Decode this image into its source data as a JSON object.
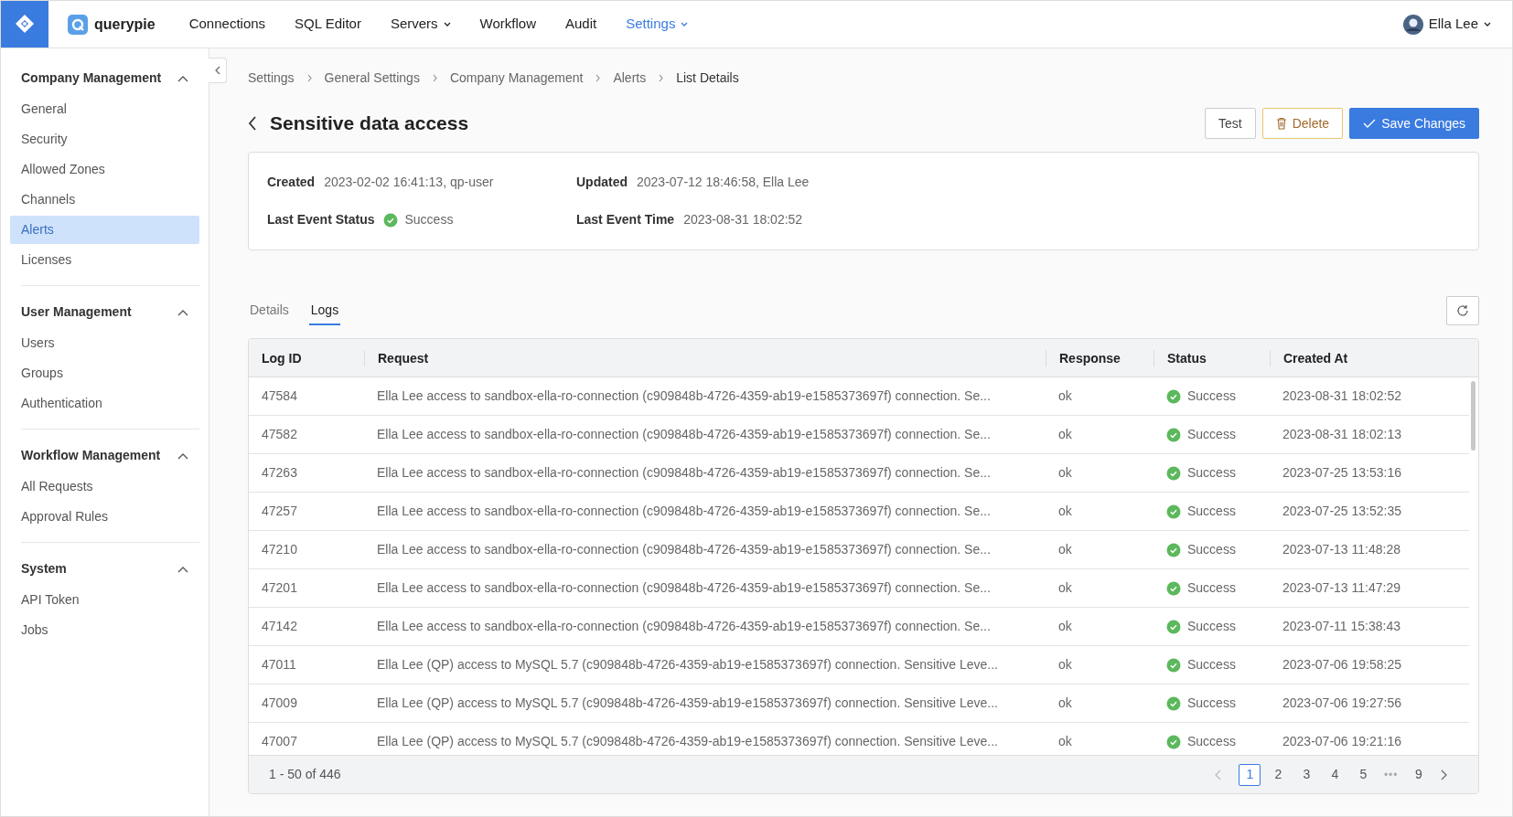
{
  "topbar": {
    "brand": "querypie",
    "nav": [
      {
        "label": "Connections",
        "dropdown": false,
        "selected": false
      },
      {
        "label": "SQL Editor",
        "dropdown": false,
        "selected": false
      },
      {
        "label": "Servers",
        "dropdown": true,
        "selected": false
      },
      {
        "label": "Workflow",
        "dropdown": false,
        "selected": false
      },
      {
        "label": "Audit",
        "dropdown": false,
        "selected": false
      },
      {
        "label": "Settings",
        "dropdown": true,
        "selected": true
      }
    ],
    "user": "Ella Lee"
  },
  "sidebar": {
    "sections": [
      {
        "title": "Company Management",
        "expanded": true,
        "items": [
          {
            "label": "General",
            "selected": false
          },
          {
            "label": "Security",
            "selected": false
          },
          {
            "label": "Allowed Zones",
            "selected": false
          },
          {
            "label": "Channels",
            "selected": false
          },
          {
            "label": "Alerts",
            "selected": true
          },
          {
            "label": "Licenses",
            "selected": false
          }
        ]
      },
      {
        "title": "User Management",
        "expanded": true,
        "items": [
          {
            "label": "Users",
            "selected": false
          },
          {
            "label": "Groups",
            "selected": false
          },
          {
            "label": "Authentication",
            "selected": false
          }
        ]
      },
      {
        "title": "Workflow Management",
        "expanded": true,
        "items": [
          {
            "label": "All Requests",
            "selected": false
          },
          {
            "label": "Approval Rules",
            "selected": false
          }
        ]
      },
      {
        "title": "System",
        "expanded": true,
        "items": [
          {
            "label": "API Token",
            "selected": false
          },
          {
            "label": "Jobs",
            "selected": false
          }
        ]
      }
    ]
  },
  "breadcrumb": [
    "Settings",
    "General Settings",
    "Company Management",
    "Alerts",
    "List Details"
  ],
  "title": "Sensitive data access",
  "actions": [
    {
      "label": "Test",
      "kind": "outline"
    },
    {
      "label": "Delete",
      "kind": "danger"
    },
    {
      "label": "Save Changes",
      "kind": "primary"
    }
  ],
  "info": [
    {
      "label": "Created",
      "value": "2023-02-02 16:41:13, qp-user",
      "kind": "text"
    },
    {
      "label": "Updated",
      "value": "2023-07-12 18:46:58, Ella Lee",
      "kind": "text"
    },
    {
      "label": "Last Event Status",
      "value": "Success",
      "kind": "status"
    },
    {
      "label": "Last Event Time",
      "value": "2023-08-31 18:02:52",
      "kind": "text"
    }
  ],
  "tabs": [
    {
      "label": "Details",
      "selected": false
    },
    {
      "label": "Logs",
      "selected": true
    }
  ],
  "table": {
    "columns": [
      "Log ID",
      "Request",
      "Response",
      "Status",
      "Created At"
    ],
    "rows": [
      {
        "id": "47584",
        "request": "Ella Lee access to sandbox-ella-ro-connection (c909848b-4726-4359-ab19-e1585373697f) connection. Se...",
        "response": "ok",
        "status": "Success",
        "created": "2023-08-31 18:02:52"
      },
      {
        "id": "47582",
        "request": "Ella Lee access to sandbox-ella-ro-connection (c909848b-4726-4359-ab19-e1585373697f) connection. Se...",
        "response": "ok",
        "status": "Success",
        "created": "2023-08-31 18:02:13"
      },
      {
        "id": "47263",
        "request": "Ella Lee access to sandbox-ella-ro-connection (c909848b-4726-4359-ab19-e1585373697f) connection. Se...",
        "response": "ok",
        "status": "Success",
        "created": "2023-07-25 13:53:16"
      },
      {
        "id": "47257",
        "request": "Ella Lee access to sandbox-ella-ro-connection (c909848b-4726-4359-ab19-e1585373697f) connection. Se...",
        "response": "ok",
        "status": "Success",
        "created": "2023-07-25 13:52:35"
      },
      {
        "id": "47210",
        "request": "Ella Lee access to sandbox-ella-ro-connection (c909848b-4726-4359-ab19-e1585373697f) connection. Se...",
        "response": "ok",
        "status": "Success",
        "created": "2023-07-13 11:48:28"
      },
      {
        "id": "47201",
        "request": "Ella Lee access to sandbox-ella-ro-connection (c909848b-4726-4359-ab19-e1585373697f) connection. Se...",
        "response": "ok",
        "status": "Success",
        "created": "2023-07-13 11:47:29"
      },
      {
        "id": "47142",
        "request": "Ella Lee access to sandbox-ella-ro-connection (c909848b-4726-4359-ab19-e1585373697f) connection. Se...",
        "response": "ok",
        "status": "Success",
        "created": "2023-07-11 15:38:43"
      },
      {
        "id": "47011",
        "request": "Ella Lee (QP) access to MySQL 5.7 (c909848b-4726-4359-ab19-e1585373697f) connection. Sensitive Leve...",
        "response": "ok",
        "status": "Success",
        "created": "2023-07-06 19:58:25"
      },
      {
        "id": "47009",
        "request": "Ella Lee (QP) access to MySQL 5.7 (c909848b-4726-4359-ab19-e1585373697f) connection. Sensitive Leve...",
        "response": "ok",
        "status": "Success",
        "created": "2023-07-06 19:27:56"
      },
      {
        "id": "47007",
        "request": "Ella Lee (QP) access to MySQL 5.7 (c909848b-4726-4359-ab19-e1585373697f) connection. Sensitive Leve...",
        "response": "ok",
        "status": "Success",
        "created": "2023-07-06 19:21:16"
      }
    ]
  },
  "pagination": {
    "summary": "1 - 50 of 446",
    "pages": [
      {
        "label": "1",
        "selected": true,
        "kind": "page"
      },
      {
        "label": "2",
        "selected": false,
        "kind": "page"
      },
      {
        "label": "3",
        "selected": false,
        "kind": "page"
      },
      {
        "label": "4",
        "selected": false,
        "kind": "page"
      },
      {
        "label": "5",
        "selected": false,
        "kind": "page"
      },
      {
        "label": "•••",
        "kind": "gap"
      },
      {
        "label": "9",
        "selected": false,
        "kind": "page"
      }
    ]
  }
}
